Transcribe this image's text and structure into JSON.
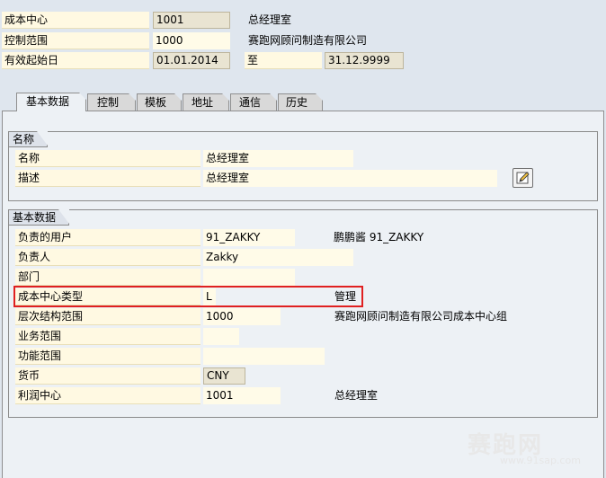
{
  "header": {
    "cost_center": {
      "label": "成本中心",
      "value": "1001",
      "desc": "总经理室"
    },
    "controlling_area": {
      "label": "控制范围",
      "value": "1000",
      "desc": "赛跑网顾问制造有限公司"
    },
    "valid_from": {
      "label": "有效起始日",
      "value": "01.01.2014",
      "to_label": "至",
      "to_value": "31.12.9999"
    }
  },
  "tabs": [
    "基本数据",
    "控制",
    "模板",
    "地址",
    "通信",
    "历史"
  ],
  "active_tab": "基本数据",
  "names_group": {
    "title": "名称",
    "name": {
      "label": "名称",
      "value": "总经理室"
    },
    "description": {
      "label": "描述",
      "value": "总经理室"
    },
    "edit_icon": "edit-pencil-icon"
  },
  "basic_group": {
    "title": "基本数据",
    "user_responsible": {
      "label": "负责的用户",
      "value": "91_ZAKKY",
      "desc": "鹏鹏酱 91_ZAKKY"
    },
    "person_responsible": {
      "label": "负责人",
      "value": "Zakky"
    },
    "department": {
      "label": "部门",
      "value": ""
    },
    "cost_center_category": {
      "label": "成本中心类型",
      "value": "L",
      "desc": "管理"
    },
    "hierarchy_area": {
      "label": "层次结构范围",
      "value": "1000",
      "desc": "赛跑网顾问制造有限公司成本中心组"
    },
    "business_area": {
      "label": "业务范围",
      "value": ""
    },
    "functional_area": {
      "label": "功能范围",
      "value": ""
    },
    "currency": {
      "label": "货币",
      "value": "CNY"
    },
    "profit_center": {
      "label": "利润中心",
      "value": "1001",
      "desc": "总经理室"
    }
  },
  "watermark": {
    "title": "赛跑网",
    "url": "www.91sap.com"
  },
  "colors": {
    "highlight": "#e02020",
    "background": "#dfe6ee",
    "input": "#fffbe8"
  }
}
